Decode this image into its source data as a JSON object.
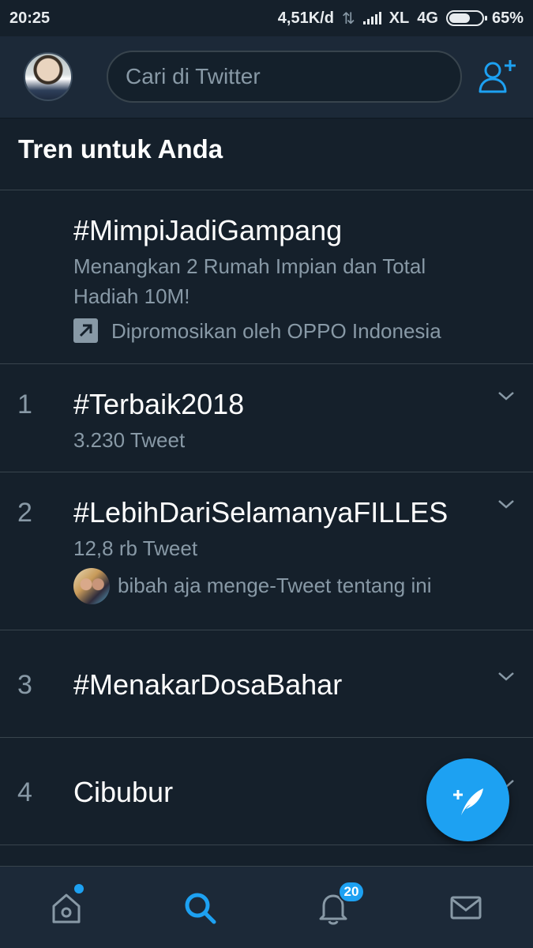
{
  "status_bar": {
    "time": "20:25",
    "network_speed": "4,51K/d",
    "carrier": "XL",
    "network_type": "4G",
    "battery": "65%"
  },
  "header": {
    "search_placeholder": "Cari di Twitter"
  },
  "section_title": "Tren untuk Anda",
  "promoted": {
    "name": "#MimpiJadiGampang",
    "description_line1": "Menangkan 2 Rumah Impian dan Total",
    "description_line2": "Hadiah 10M!",
    "promoted_by": "Dipromosikan oleh OPPO Indonesia"
  },
  "trends": [
    {
      "rank": "1",
      "name": "#Terbaik2018",
      "count": "3.230 Tweet"
    },
    {
      "rank": "2",
      "name": "#LebihDariSelamanyaFILLES",
      "count": "12,8 rb Tweet",
      "context": "bibah aja menge-Tweet tentang ini"
    },
    {
      "rank": "3",
      "name": "#MenakarDosaBahar"
    },
    {
      "rank": "4",
      "name": "Cibubur"
    }
  ],
  "bottom_nav": {
    "notifications_badge": "20"
  },
  "colors": {
    "accent": "#1da1f2",
    "background": "#15202b",
    "header": "#1c2938",
    "secondary_text": "#8899a6"
  }
}
